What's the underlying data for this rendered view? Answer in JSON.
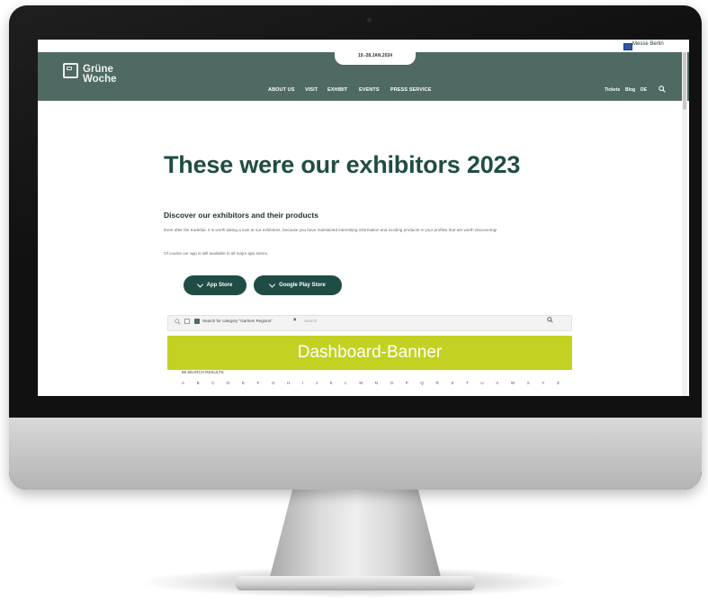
{
  "top_bar": {
    "language_link": "Messe Berlin"
  },
  "header": {
    "date": "19.-28.JAN.2024",
    "logo_line1": "Grüne",
    "logo_line2": "Woche",
    "nav": [
      "ABOUT US",
      "VISIT",
      "EXHIBIT",
      "EVENTS",
      "PRESS SERVICE"
    ],
    "utility": [
      "Tickets",
      "Blog",
      "DE"
    ]
  },
  "main": {
    "title": "These were our exhibitors 2023",
    "subtitle": "Discover our exhibitors and their products",
    "paragraph1": "Even after the tradefair, it is worth taking a look at our exhibitors, because you have maintained interesting information and exciting products in your profiles that are worth discovering!",
    "paragraph2": "Of course our app is still available in all major app stores.",
    "buttons": [
      "App Store",
      "Google Play Store"
    ]
  },
  "search": {
    "filter_chip": "Search for category \"Gartnen Regions\"",
    "clear": "×",
    "placeholder": "Search"
  },
  "banner": {
    "text": "Dashboard-Banner"
  },
  "results": {
    "label": "88 SEARCH RESULTS",
    "letters": [
      "A",
      "B",
      "C",
      "D",
      "E",
      "F",
      "G",
      "H",
      "I",
      "J",
      "K",
      "L",
      "M",
      "N",
      "O",
      "P",
      "Q",
      "R",
      "S",
      "T",
      "U",
      "V",
      "W",
      "X",
      "Y",
      "Z"
    ]
  },
  "colors": {
    "nav_bg": "#4f6a63",
    "headline": "#1f4d45",
    "button_bg": "#1f4d45",
    "banner_bg": "#c3d222"
  },
  "icons": [
    "flag-icon",
    "logo-icon",
    "search-icon",
    "chevron-down-icon",
    "checkbox-icon"
  ]
}
